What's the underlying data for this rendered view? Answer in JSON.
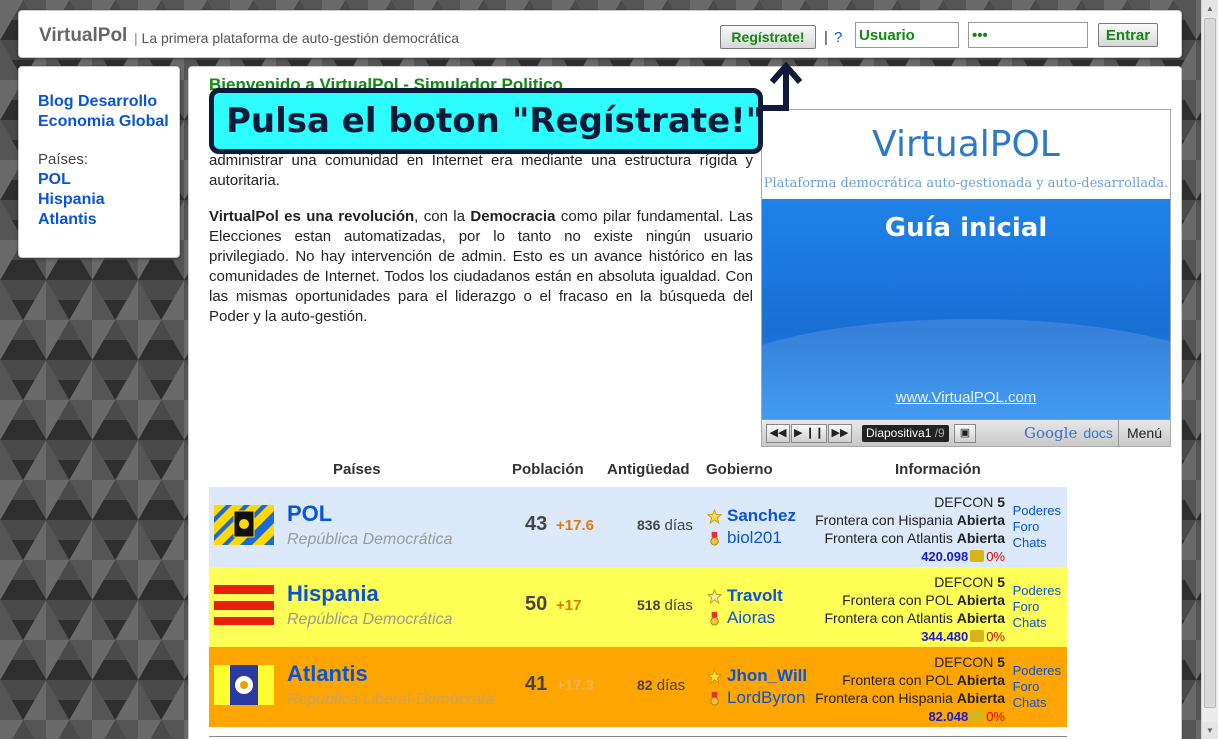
{
  "header": {
    "brand": "VirtualPol",
    "separator": "|",
    "tagline": "La primera plataforma de auto-gestión democrática",
    "register_label": "Regístrate!",
    "pipe": "|",
    "help": "?",
    "user_value": "Usuario",
    "pass_value": "•••",
    "login_label": "Entrar"
  },
  "sidebar": {
    "links": [
      "Blog Desarrollo",
      "Economia Global"
    ],
    "countries_label": "Países:",
    "countries": [
      "POL",
      "Hispania",
      "Atlantis"
    ]
  },
  "main": {
    "welcome": "Bienvenido a VirtualPol - Simulador Politico",
    "intro_p1": "administrar una comunidad en Internet era mediante una estructura rígida y autoritaria.",
    "intro_p2_bold": "VirtualPol es una revolución",
    "intro_p2_a": ", con la ",
    "intro_p2_bold2": "Democracia",
    "intro_p2_b": " como pilar fundamental. Las Elecciones estan automatizadas, por lo tanto no existe ningún usuario privilegiado. No hay intervención de admin. Esto es un avance histórico en las comunidades de Internet. Todos los ciudadanos están en absoluta igualdad. Con las mismas oportunidades para el liderazgo o el fracaso en la búsqueda del Poder y la auto-gestión."
  },
  "callout": "Pulsa el boton \"Regístrate!\"",
  "slides": {
    "logo_a": "Virtual",
    "logo_b": "POL",
    "subtitle": "Plataforma democrática auto-gestionada y auto-desarrollada.",
    "title": "Guía inicial",
    "url": "www.VirtualPOL.com",
    "indicator": "Diapositiva1",
    "total": "/9",
    "google": "Google",
    "docs": "docs",
    "menu": "Menú"
  },
  "table": {
    "headers": [
      "Países",
      "Población",
      "Antigüedad",
      "Gobierno",
      "Información"
    ],
    "rows": [
      {
        "name": "POL",
        "type": "República Democrática",
        "population": "43",
        "growth": "+17.6",
        "days": "836",
        "days_unit": "días",
        "gov1": "Sanchez",
        "gov2": "biol201",
        "defcon_label": "DEFCON",
        "defcon": "5",
        "border1": "Frontera con Hispania",
        "border1_state": "Abierta",
        "border2": "Frontera con Atlantis",
        "border2_state": "Abierta",
        "money": "420.098",
        "pct": "0%",
        "links": [
          "Poderes",
          "Foro",
          "Chats"
        ]
      },
      {
        "name": "Hispania",
        "type": "República Democrática",
        "population": "50",
        "growth": "+17",
        "days": "518",
        "days_unit": "días",
        "gov1": "Travolt",
        "gov2": "Aioras",
        "defcon_label": "DEFCON",
        "defcon": "5",
        "border1": "Frontera con POL",
        "border1_state": "Abierta",
        "border2": "Frontera con Atlantis",
        "border2_state": "Abierta",
        "money": "344.480",
        "pct": "0%",
        "links": [
          "Poderes",
          "Foro",
          "Chats"
        ]
      },
      {
        "name": "Atlantis",
        "type": "República Liberal-Demócrata",
        "population": "41",
        "growth": "+17.3",
        "days": "82",
        "days_unit": "días",
        "gov1": "Jhon_Will",
        "gov2": "LordByron",
        "defcon_label": "DEFCON",
        "defcon": "5",
        "border1": "Frontera con POL",
        "border1_state": "Abierta",
        "border2": "Frontera con Hispania",
        "border2_state": "Abierta",
        "money": "82.048",
        "pct": "0%",
        "links": [
          "Poderes",
          "Foro",
          "Chats"
        ]
      }
    ]
  }
}
